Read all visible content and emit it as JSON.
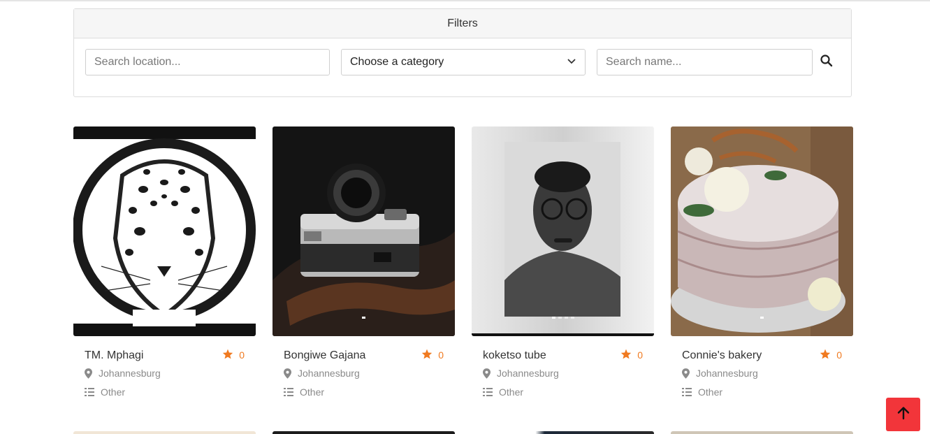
{
  "filters": {
    "title": "Filters",
    "location_placeholder": "Search location...",
    "category_value": "Choose a category",
    "name_placeholder": "Search name..."
  },
  "icons": {
    "search": "search-icon",
    "chevron": "chevron-down-icon",
    "star": "star-icon",
    "location": "map-pin-icon",
    "category": "list-icon",
    "scroll_top": "arrow-up-icon"
  },
  "colors": {
    "star": "#f07a20",
    "scroll_top": "#f2353a"
  },
  "cards": [
    {
      "name": "TM. Mphagi",
      "rating": "0",
      "location": "Johannesburg",
      "category": "Other"
    },
    {
      "name": "Bongiwe Gajana",
      "rating": "0",
      "location": "Johannesburg",
      "category": "Other"
    },
    {
      "name": "koketso tube",
      "rating": "0",
      "location": "Johannesburg",
      "category": "Other"
    },
    {
      "name": "Connie's bakery",
      "rating": "0",
      "location": "Johannesburg",
      "category": "Other"
    }
  ]
}
